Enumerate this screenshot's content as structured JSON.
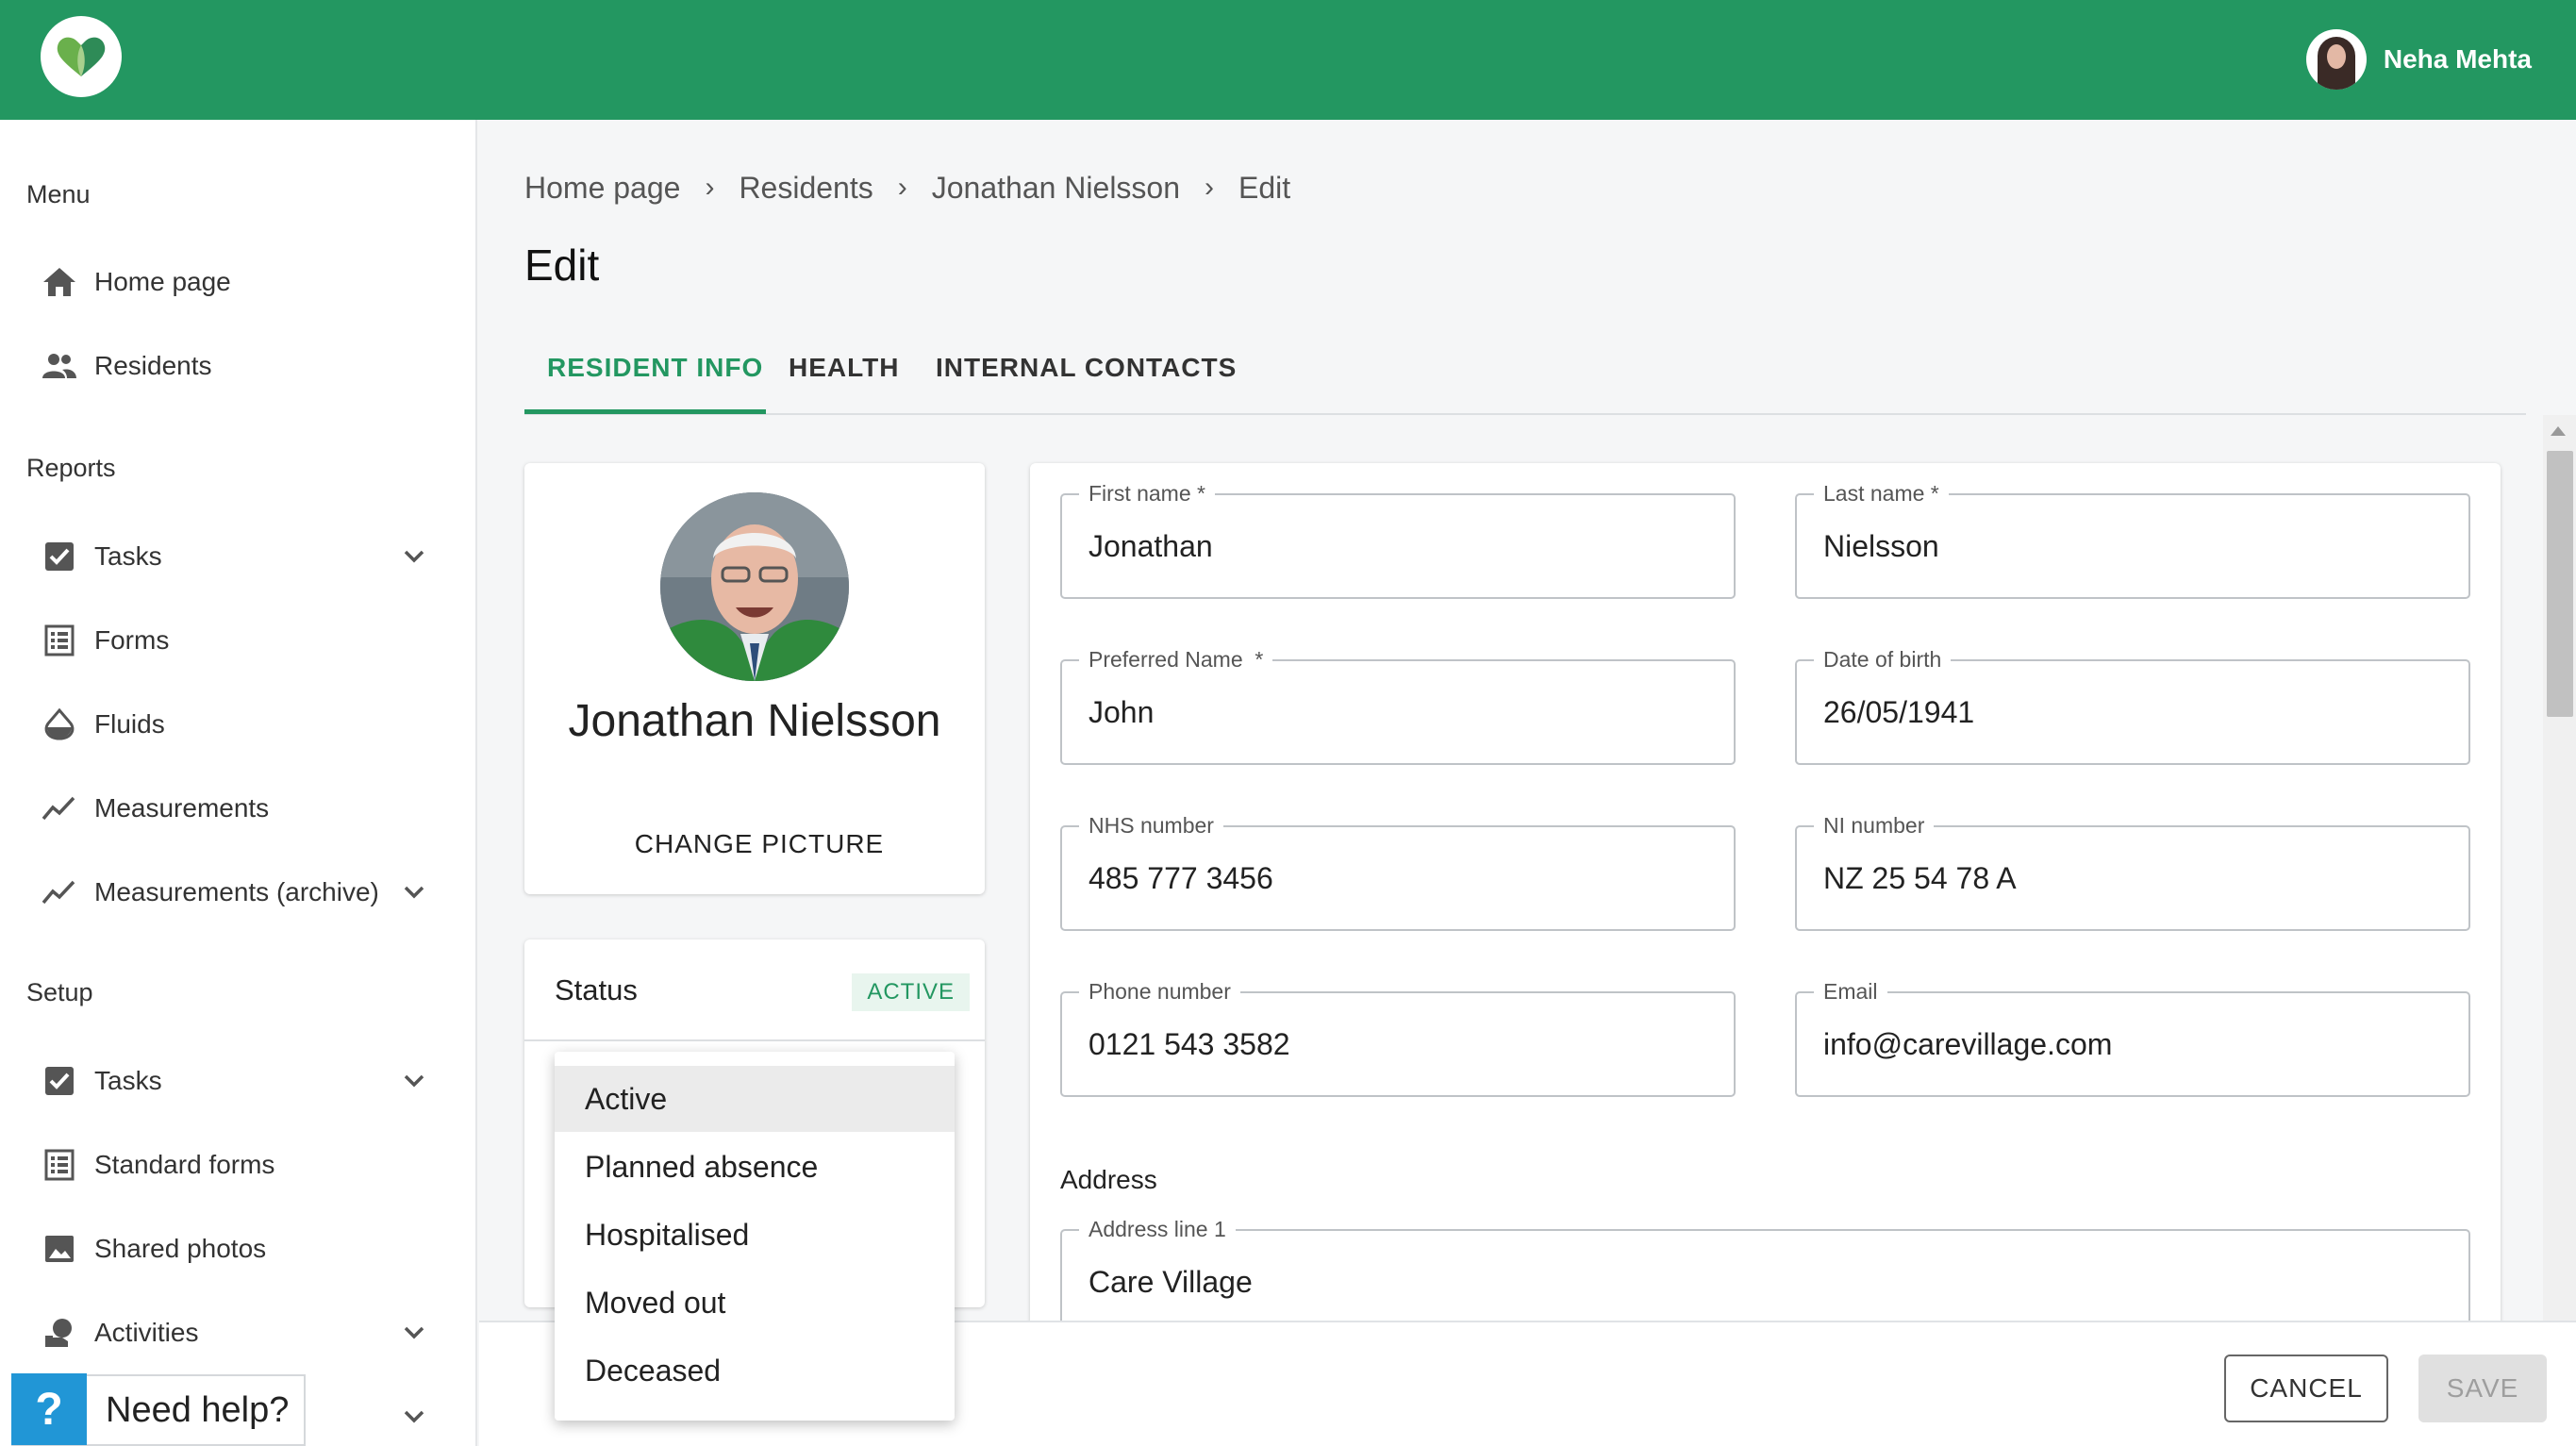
{
  "header": {
    "logo_icon": "care-heart-logo-icon",
    "user_name": "Neha Mehta"
  },
  "sidebar": {
    "sections": {
      "menu": "Menu",
      "reports": "Reports",
      "setup": "Setup"
    },
    "items": [
      {
        "label": "Home page",
        "icon": "home-icon"
      },
      {
        "label": "Residents",
        "icon": "people-icon"
      },
      {
        "label": "Tasks",
        "icon": "checkbox-icon"
      },
      {
        "label": "Forms",
        "icon": "list-icon"
      },
      {
        "label": "Fluids",
        "icon": "drop-icon"
      },
      {
        "label": "Measurements",
        "icon": "trend-icon"
      },
      {
        "label": "Measurements (archive)",
        "icon": "trend-icon"
      },
      {
        "label": "Tasks",
        "icon": "checkbox-icon"
      },
      {
        "label": "Standard forms",
        "icon": "list-icon"
      },
      {
        "label": "Shared photos",
        "icon": "image-icon"
      },
      {
        "label": "Activities",
        "icon": "activity-icon"
      }
    ],
    "help_label": "Need help?",
    "help_icon_text": "?"
  },
  "breadcrumb": [
    "Home page",
    "Residents",
    "Jonathan Nielsson",
    "Edit"
  ],
  "page_title": "Edit",
  "tabs": [
    "RESIDENT INFO",
    "HEALTH",
    "INTERNAL CONTACTS"
  ],
  "profile": {
    "name": "Jonathan Nielsson",
    "change_picture": "CHANGE PICTURE"
  },
  "status": {
    "label": "Status",
    "badge": "ACTIVE",
    "options": [
      "Active",
      "Planned absence",
      "Hospitalised",
      "Moved out",
      "Deceased"
    ],
    "selected": "Active"
  },
  "form": {
    "first_name": {
      "label": "First name *",
      "value": "Jonathan"
    },
    "last_name": {
      "label": "Last name *",
      "value": "Nielsson"
    },
    "preferred_name": {
      "label": "Preferred Name  *",
      "value": "John"
    },
    "dob": {
      "label": "Date of birth",
      "value": "26/05/1941"
    },
    "nhs": {
      "label": "NHS number",
      "value": "485 777 3456"
    },
    "ni": {
      "label": "NI number",
      "value": "NZ 25 54 78 A"
    },
    "phone": {
      "label": "Phone number",
      "value": "0121 543 3582"
    },
    "email": {
      "label": "Email",
      "value": "info@carevillage.com"
    },
    "address_title": "Address",
    "address_line1": {
      "label": "Address line 1",
      "value": "Care Village"
    }
  },
  "actions": {
    "cancel": "CANCEL",
    "save": "SAVE"
  },
  "colors": {
    "brand_green": "#239761",
    "help_blue": "#2196d6"
  }
}
